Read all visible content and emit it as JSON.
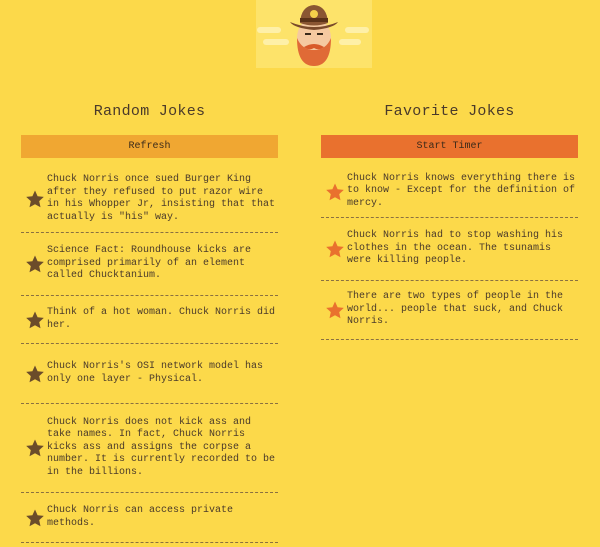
{
  "colors": {
    "background": "#fcd94a",
    "refresh_button": "#f0a732",
    "timer_button": "#e9712e",
    "star_random": "#6b4c2a",
    "star_favorite": "#e9712e"
  },
  "logo": {
    "icon": "cowboy-face-icon"
  },
  "random": {
    "title": "Random Jokes",
    "button_label": "Refresh",
    "jokes": [
      "Chuck Norris once sued Burger King after they refused to put razor wire in his Whopper Jr, insisting that that actually is \"his\" way.",
      "Science Fact: Roundhouse kicks are comprised primarily of an element called Chucktanium.",
      "Think of a hot woman. Chuck Norris did her.",
      "Chuck Norris's OSI network model has only one layer - Physical.",
      "Chuck Norris does not kick ass and take names. In fact, Chuck Norris kicks ass and assigns the corpse a number. It is currently recorded to be in the billions.",
      "Chuck Norris can access private methods."
    ]
  },
  "favorites": {
    "title": "Favorite Jokes",
    "button_label": "Start Timer",
    "jokes": [
      "Chuck Norris knows everything there is to know - Except for the definition of mercy.",
      "Chuck Norris had to stop washing his clothes in the ocean. The tsunamis were killing people.",
      "There are two types of people in the world... people that suck, and Chuck Norris."
    ]
  }
}
